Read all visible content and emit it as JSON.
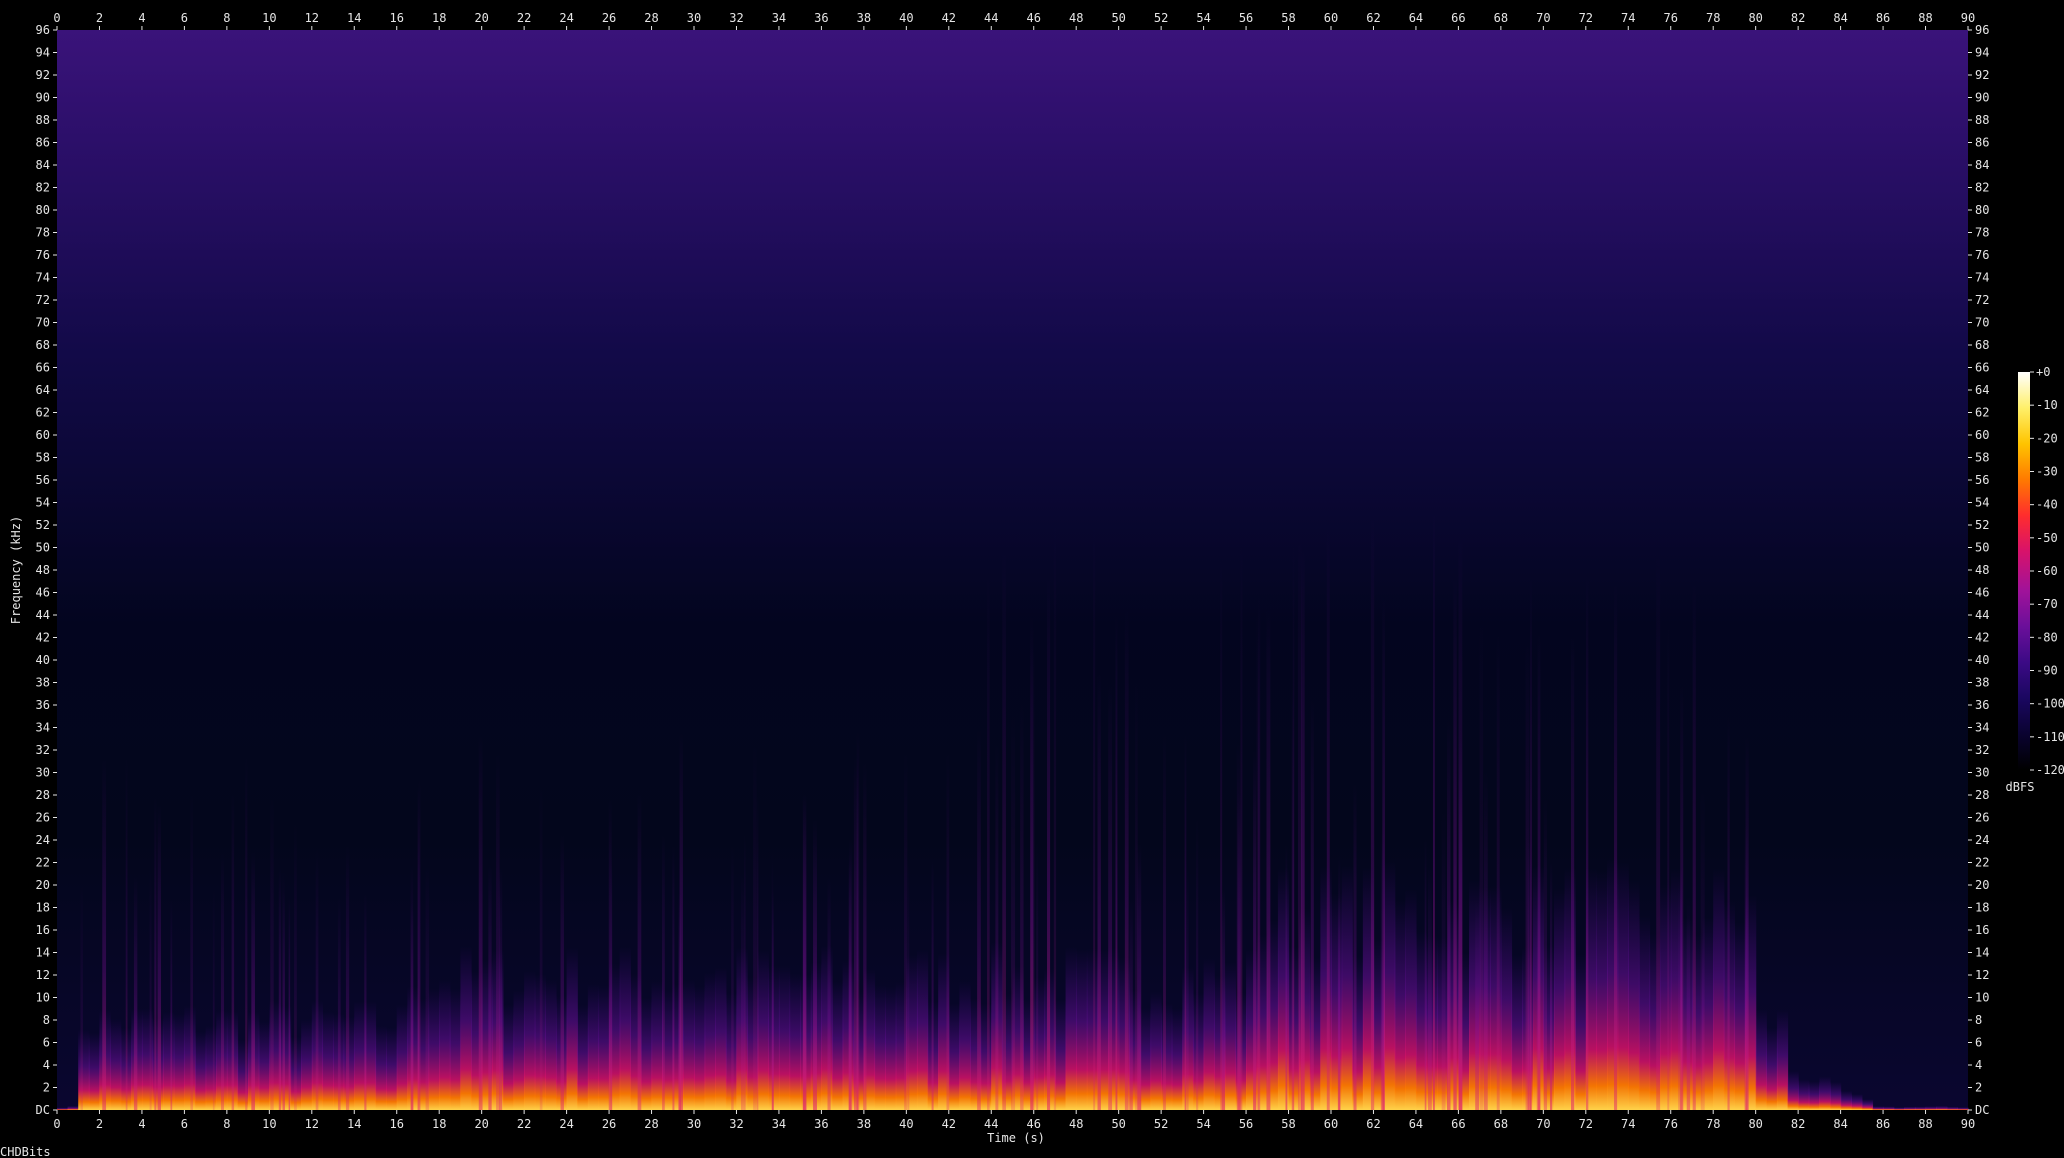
{
  "footer_label": "CHDBits",
  "chart_data": {
    "type": "heatmap",
    "title": "",
    "xlabel": "Time (s)",
    "ylabel": "Frequency (kHz)",
    "xlim": [
      0,
      90
    ],
    "ylim": [
      0,
      96
    ],
    "x_ticks": [
      "0",
      "2",
      "4",
      "6",
      "8",
      "10",
      "12",
      "14",
      "16",
      "18",
      "20",
      "22",
      "24",
      "26",
      "28",
      "30",
      "32",
      "34",
      "36",
      "38",
      "40",
      "42",
      "44",
      "46",
      "48",
      "50",
      "52",
      "54",
      "56",
      "58",
      "60",
      "62",
      "64",
      "66",
      "68",
      "70",
      "72",
      "74",
      "76",
      "78",
      "80",
      "82",
      "84",
      "86",
      "88",
      "90"
    ],
    "y_ticks": [
      "DC",
      "2",
      "4",
      "6",
      "8",
      "10",
      "12",
      "14",
      "16",
      "18",
      "20",
      "22",
      "24",
      "26",
      "28",
      "30",
      "32",
      "34",
      "36",
      "38",
      "40",
      "42",
      "44",
      "46",
      "48",
      "50",
      "52",
      "54",
      "56",
      "58",
      "60",
      "62",
      "64",
      "66",
      "68",
      "70",
      "72",
      "74",
      "76",
      "78",
      "80",
      "82",
      "84",
      "86",
      "88",
      "90",
      "92",
      "94",
      "96"
    ],
    "colorbar": {
      "label": "dBFS",
      "ticks": [
        "+0",
        "-10",
        "-20",
        "-30",
        "-40",
        "-50",
        "-60",
        "-70",
        "-80",
        "-90",
        "-100",
        "-110",
        "-120"
      ],
      "range": [
        -120,
        0
      ],
      "colors": [
        "#000000",
        "#0a0330",
        "#1a0760",
        "#3b0a85",
        "#6a0f9a",
        "#a0129a",
        "#d8126a",
        "#ff2d2d",
        "#ff7a00",
        "#ffc400",
        "#fff06a",
        "#ffffff"
      ]
    },
    "grid": false
  }
}
